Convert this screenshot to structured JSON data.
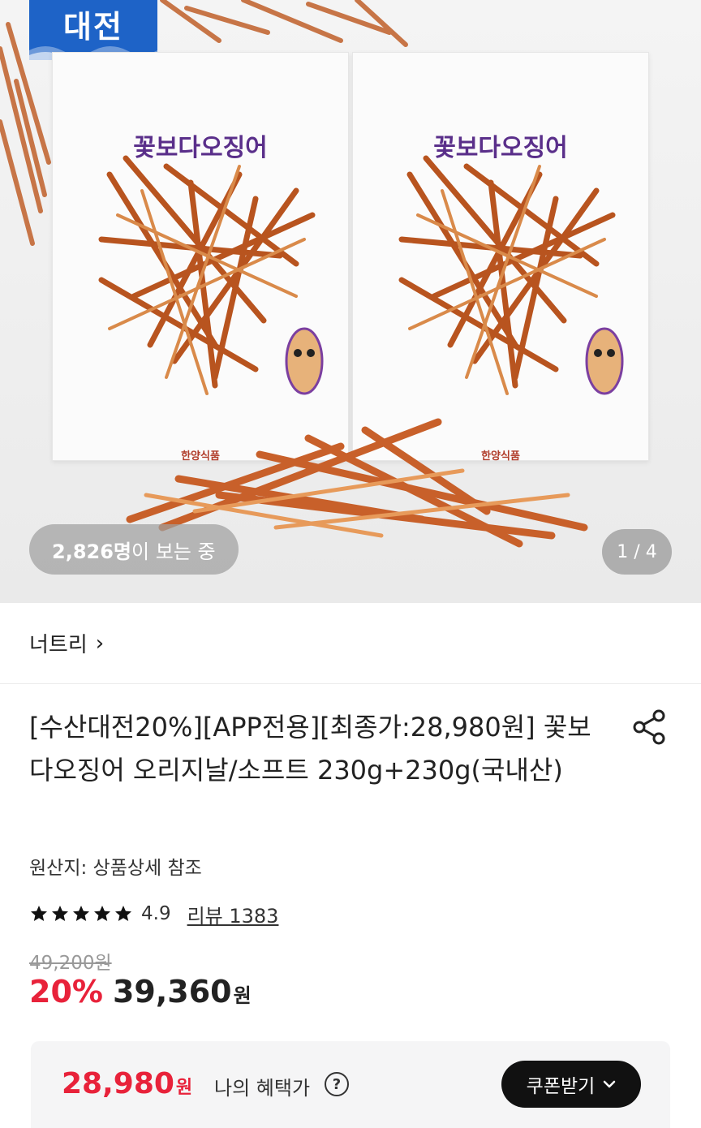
{
  "hero": {
    "badge_text": "대전",
    "bag_logo": "꽃보다오징어",
    "bag_maker": "한양식품",
    "viewers_count": "2,826명",
    "viewers_suffix": "이 보는 중",
    "page_counter": "1 / 4"
  },
  "seller": {
    "name": "너트리",
    "chevron": "›"
  },
  "product": {
    "title": "[수산대전20%][APP전용][최종가:28,980원] 꽃보다오징어 오리지날/소프트 230g+230g(국내산)",
    "origin": "원산지: 상품상세 참조",
    "rating": "4.9",
    "stars": 5,
    "review_link": "리뷰 1383",
    "original_price": "49,200원",
    "discount": "20%",
    "price": "39,360",
    "price_unit": "원"
  },
  "benefit": {
    "amount": "28,980",
    "unit": "원",
    "label": "나의 혜택가",
    "help": "?",
    "coupon_button": "쿠폰받기"
  },
  "icons": {
    "share": "share-icon",
    "star": "star-icon",
    "help": "question-circle-icon",
    "chevron_down": "chevron-down-icon"
  },
  "colors": {
    "accent_red": "#e8223a",
    "badge_blue": "#1e63c7",
    "button_black": "#111111"
  }
}
